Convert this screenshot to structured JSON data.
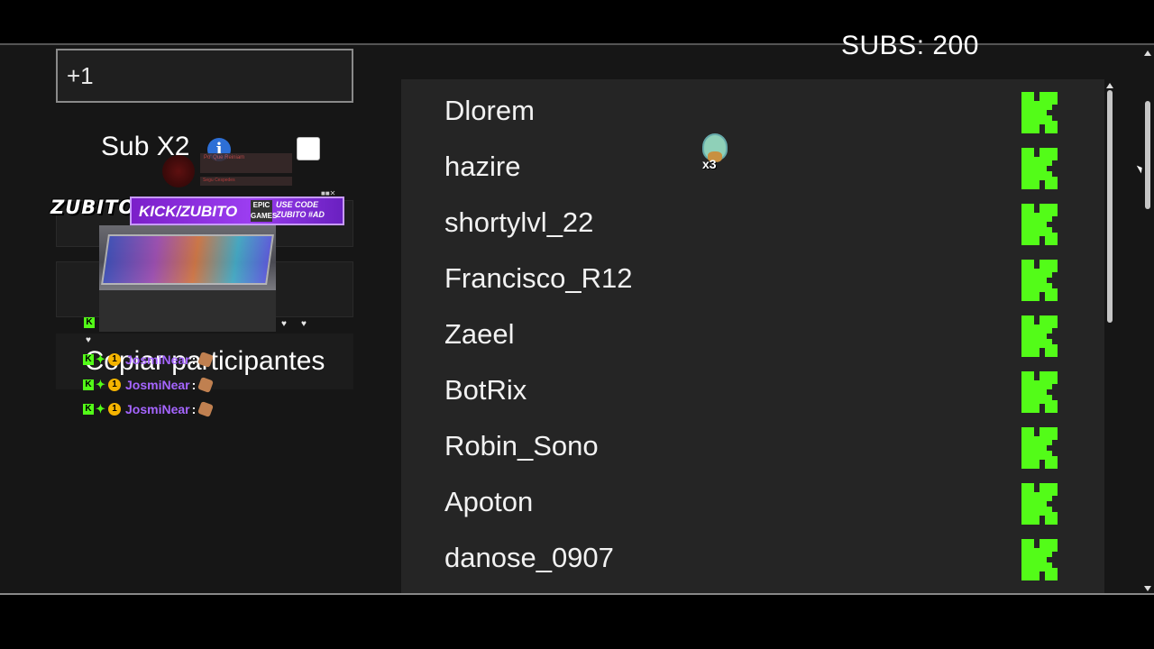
{
  "counter": {
    "subs_text": "SUBS: 200"
  },
  "left": {
    "input_value": "+1",
    "sub_label": "Sub X2",
    "info_icon": "i",
    "copy_button": "Copiar participantes"
  },
  "overlay": {
    "logo": "ZUBITO",
    "banner": "KICK/ZUBITO",
    "epic": "EPIC GAMES",
    "code": "USE CODE ZUBITO #AD",
    "live_title": "Po' Que Reiniam",
    "live_sub": "Segu Cespedes",
    "chat": [
      {
        "name": "JosmiNear",
        "colon": ":"
      },
      {
        "name": "JosmiNear",
        "colon": ":"
      },
      {
        "name": "JosmiNear",
        "colon": ":"
      }
    ]
  },
  "emote": {
    "count": "x3"
  },
  "participants": [
    {
      "name": "Dlorem"
    },
    {
      "name": "hazire"
    },
    {
      "name": "shortylvl_22"
    },
    {
      "name": "Francisco_R12"
    },
    {
      "name": "Zaeel"
    },
    {
      "name": "BotRix"
    },
    {
      "name": "Robin_Sono"
    },
    {
      "name": "Apoton"
    },
    {
      "name": "danose_0907"
    }
  ],
  "colors": {
    "kick_green": "#53fc18",
    "panel": "#252525",
    "bg": "#161616",
    "chat_name": "#a565ff"
  },
  "icons": {
    "platform": "kick-logo-icon",
    "info": "info-icon",
    "emote": "squirtle-emote-icon"
  }
}
